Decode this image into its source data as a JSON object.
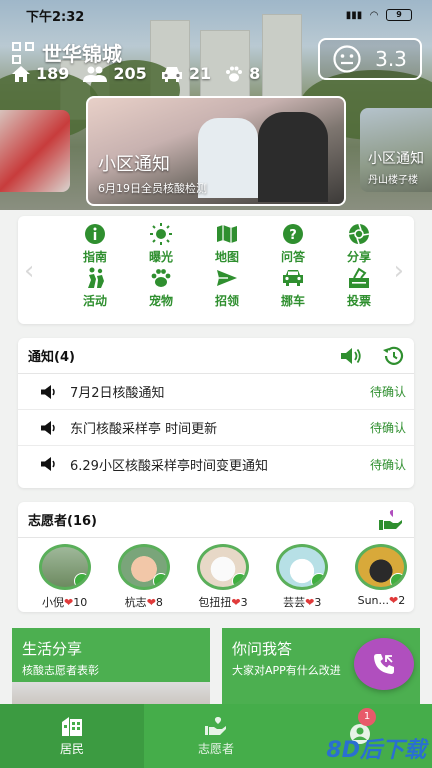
{
  "status_bar": {
    "time": "下午2:32",
    "battery": "9"
  },
  "header": {
    "community_name": "世华锦城",
    "stats": {
      "houses": "189",
      "residents": "205",
      "cars": "21",
      "pets": "8"
    },
    "score": "3.3"
  },
  "banners": [
    {
      "title": "",
      "subtitle": ""
    },
    {
      "title": "小区通知",
      "subtitle": "6月19日全员核酸检测"
    },
    {
      "title": "小区通知",
      "subtitle": "丹山楼子楼"
    }
  ],
  "functions": [
    {
      "label": "指南",
      "icon": "info-icon"
    },
    {
      "label": "曝光",
      "icon": "sun-icon"
    },
    {
      "label": "地图",
      "icon": "map-icon"
    },
    {
      "label": "问答",
      "icon": "question-icon"
    },
    {
      "label": "分享",
      "icon": "aperture-icon"
    },
    {
      "label": "活动",
      "icon": "activity-icon"
    },
    {
      "label": "宠物",
      "icon": "paw-icon"
    },
    {
      "label": "招领",
      "icon": "send-icon"
    },
    {
      "label": "挪车",
      "icon": "car-icon"
    },
    {
      "label": "投票",
      "icon": "ballot-icon"
    }
  ],
  "notices": {
    "title": "通知(4)",
    "items": [
      {
        "text": "7月2日核酸通知",
        "status": "待确认"
      },
      {
        "text": "东门核酸采样亭 时间更新",
        "status": "待确认"
      },
      {
        "text": "6.29小区核酸采样亭时间变更通知",
        "status": "待确认"
      }
    ]
  },
  "volunteers": {
    "title": "志愿者(16)",
    "items": [
      {
        "name": "小倪",
        "count": "10"
      },
      {
        "name": "杭志",
        "count": "8"
      },
      {
        "name": "包扭扭",
        "count": "3"
      },
      {
        "name": "芸芸",
        "count": "3"
      },
      {
        "name": "Sun...",
        "count": "2"
      }
    ]
  },
  "panels": [
    {
      "title": "生活分享",
      "subtitle": "核酸志愿者表彰"
    },
    {
      "title": "你问我答",
      "subtitle": "大家对APP有什么改进"
    }
  ],
  "nav": {
    "tabs": [
      {
        "label": "居民"
      },
      {
        "label": "志愿者"
      },
      {
        "label": ""
      }
    ],
    "badge": "1"
  },
  "watermark": "8D后下载",
  "colors": {
    "primary_green": "#45ad4a",
    "accent_purple": "#b04fbe",
    "heart_red": "#e03a3a"
  }
}
